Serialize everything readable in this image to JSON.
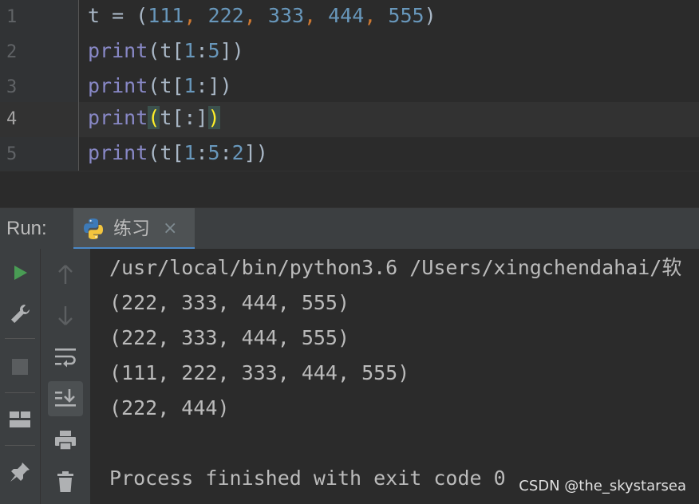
{
  "editor": {
    "lines": [
      {
        "num": "1"
      },
      {
        "num": "2"
      },
      {
        "num": "3"
      },
      {
        "num": "4"
      },
      {
        "num": "5"
      }
    ],
    "code": {
      "l1": {
        "t": "t",
        "eq": " = ",
        "open": "(",
        "n1": "111",
        "n2": "222",
        "n3": "333",
        "n4": "444",
        "n5": "555",
        "comma": ",",
        "close": ")"
      },
      "l2": {
        "fn": "print",
        "pre": "(t[",
        "a": "1",
        "colon": ":",
        "b": "5",
        "post": "])"
      },
      "l3": {
        "fn": "print",
        "pre": "(t[",
        "a": "1",
        "post": ":])"
      },
      "l4": {
        "fn": "print",
        "open": "(",
        "mid": "t[:]",
        "close": ")"
      },
      "l5": {
        "fn": "print",
        "pre": "(t[",
        "a": "1",
        "c1": ":",
        "b": "5",
        "c2": ":",
        "c": "2",
        "post": "])"
      }
    }
  },
  "run": {
    "label": "Run:",
    "tab_label": "练习",
    "tab_close": "×",
    "output": [
      "/usr/local/bin/python3.6 /Users/xingchendahai/软",
      "(222, 333, 444, 555)",
      "(222, 333, 444, 555)",
      "(111, 222, 333, 444, 555)",
      "(222, 444)",
      "",
      "Process finished with exit code 0"
    ]
  },
  "watermark": "CSDN @the_skystarsea",
  "colors": {
    "background": "#2b2b2b",
    "keyword": "#8888c6",
    "number": "#6897bb",
    "comma": "#cc7832",
    "run_green": "#499c54"
  }
}
